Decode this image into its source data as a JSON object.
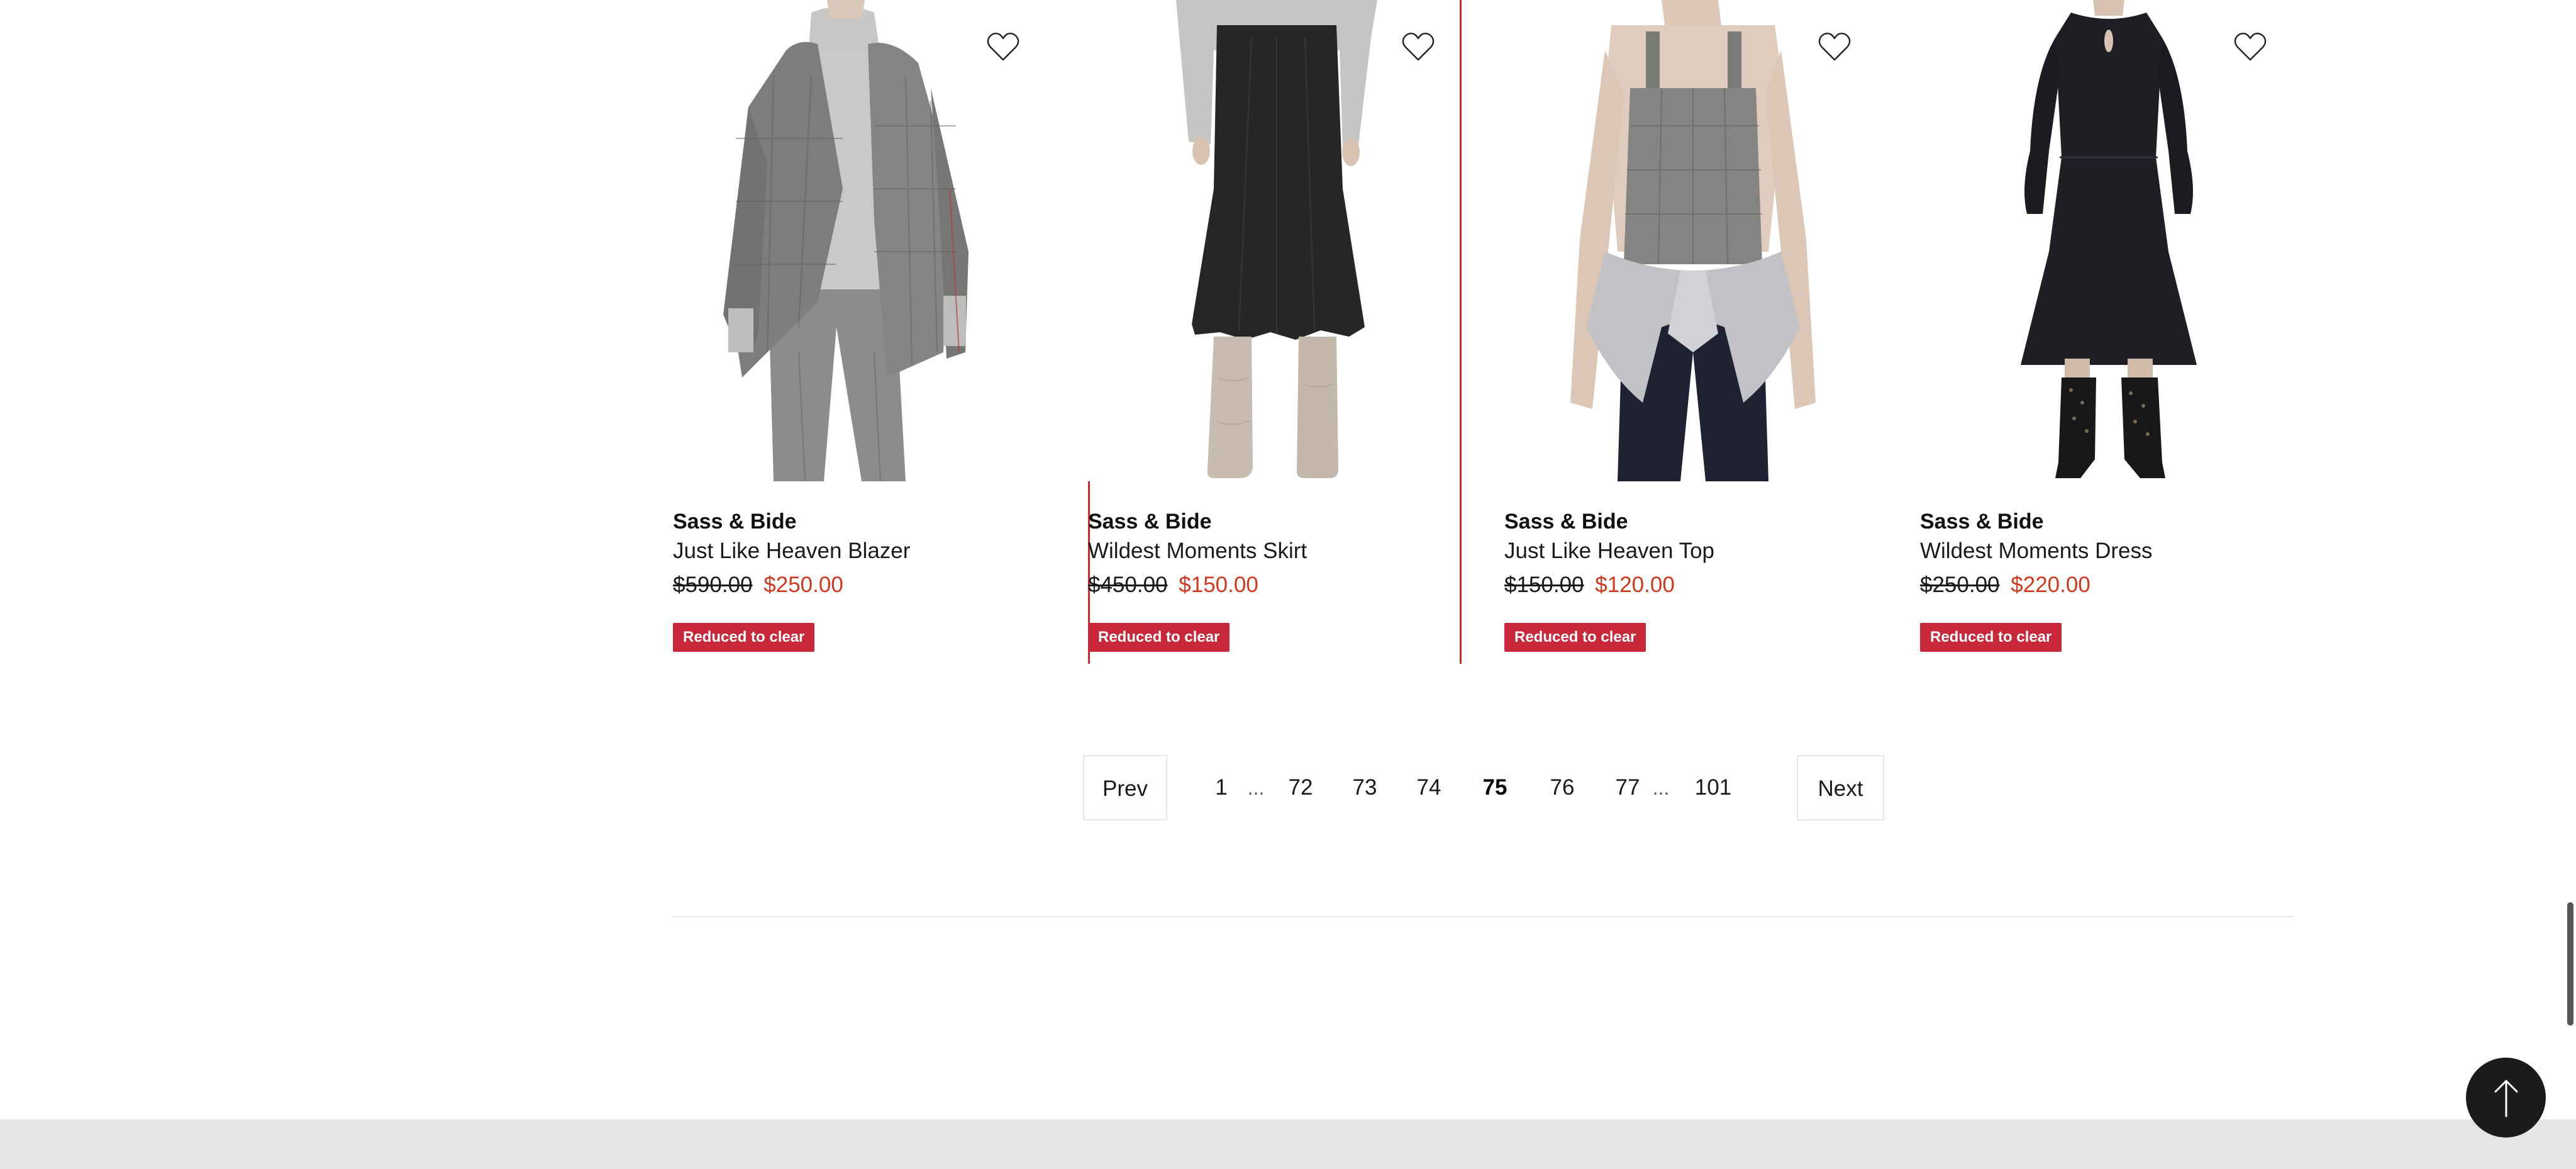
{
  "products": [
    {
      "brand": "Sass & Bide",
      "name": "Just Like Heaven Blazer",
      "old_price": "$590.00",
      "sale_price": "$250.00",
      "badge": "Reduced to clear",
      "image_icon": "grey-check-blazer-photo"
    },
    {
      "brand": "Sass & Bide",
      "name": "Wildest Moments Skirt",
      "old_price": "$450.00",
      "sale_price": "$150.00",
      "badge": "Reduced to clear",
      "image_icon": "black-midi-skirt-photo"
    },
    {
      "brand": "Sass & Bide",
      "name": "Just Like Heaven Top",
      "old_price": "$150.00",
      "sale_price": "$120.00",
      "badge": "Reduced to clear",
      "image_icon": "grey-check-bustier-top-photo"
    },
    {
      "brand": "Sass & Bide",
      "name": "Wildest Moments Dress",
      "old_price": "$250.00",
      "sale_price": "$220.00",
      "badge": "Reduced to clear",
      "image_icon": "black-midi-dress-photo"
    }
  ],
  "pagination": {
    "prev_label": "Prev",
    "next_label": "Next",
    "first": "1",
    "ellipsis": "...",
    "pages": [
      "72",
      "73",
      "74",
      "75",
      "76",
      "77"
    ],
    "current": "75",
    "last": "101"
  },
  "colors": {
    "sale_price": "#d2381e",
    "badge_bg": "#c8283a",
    "hover_outline": "#d02a2a",
    "footer_band": "#e5e5e5",
    "back_to_top_bg": "#1b1b1b"
  },
  "icons": {
    "wishlist": "heart-outline-icon",
    "back_to_top": "arrow-up-icon"
  }
}
